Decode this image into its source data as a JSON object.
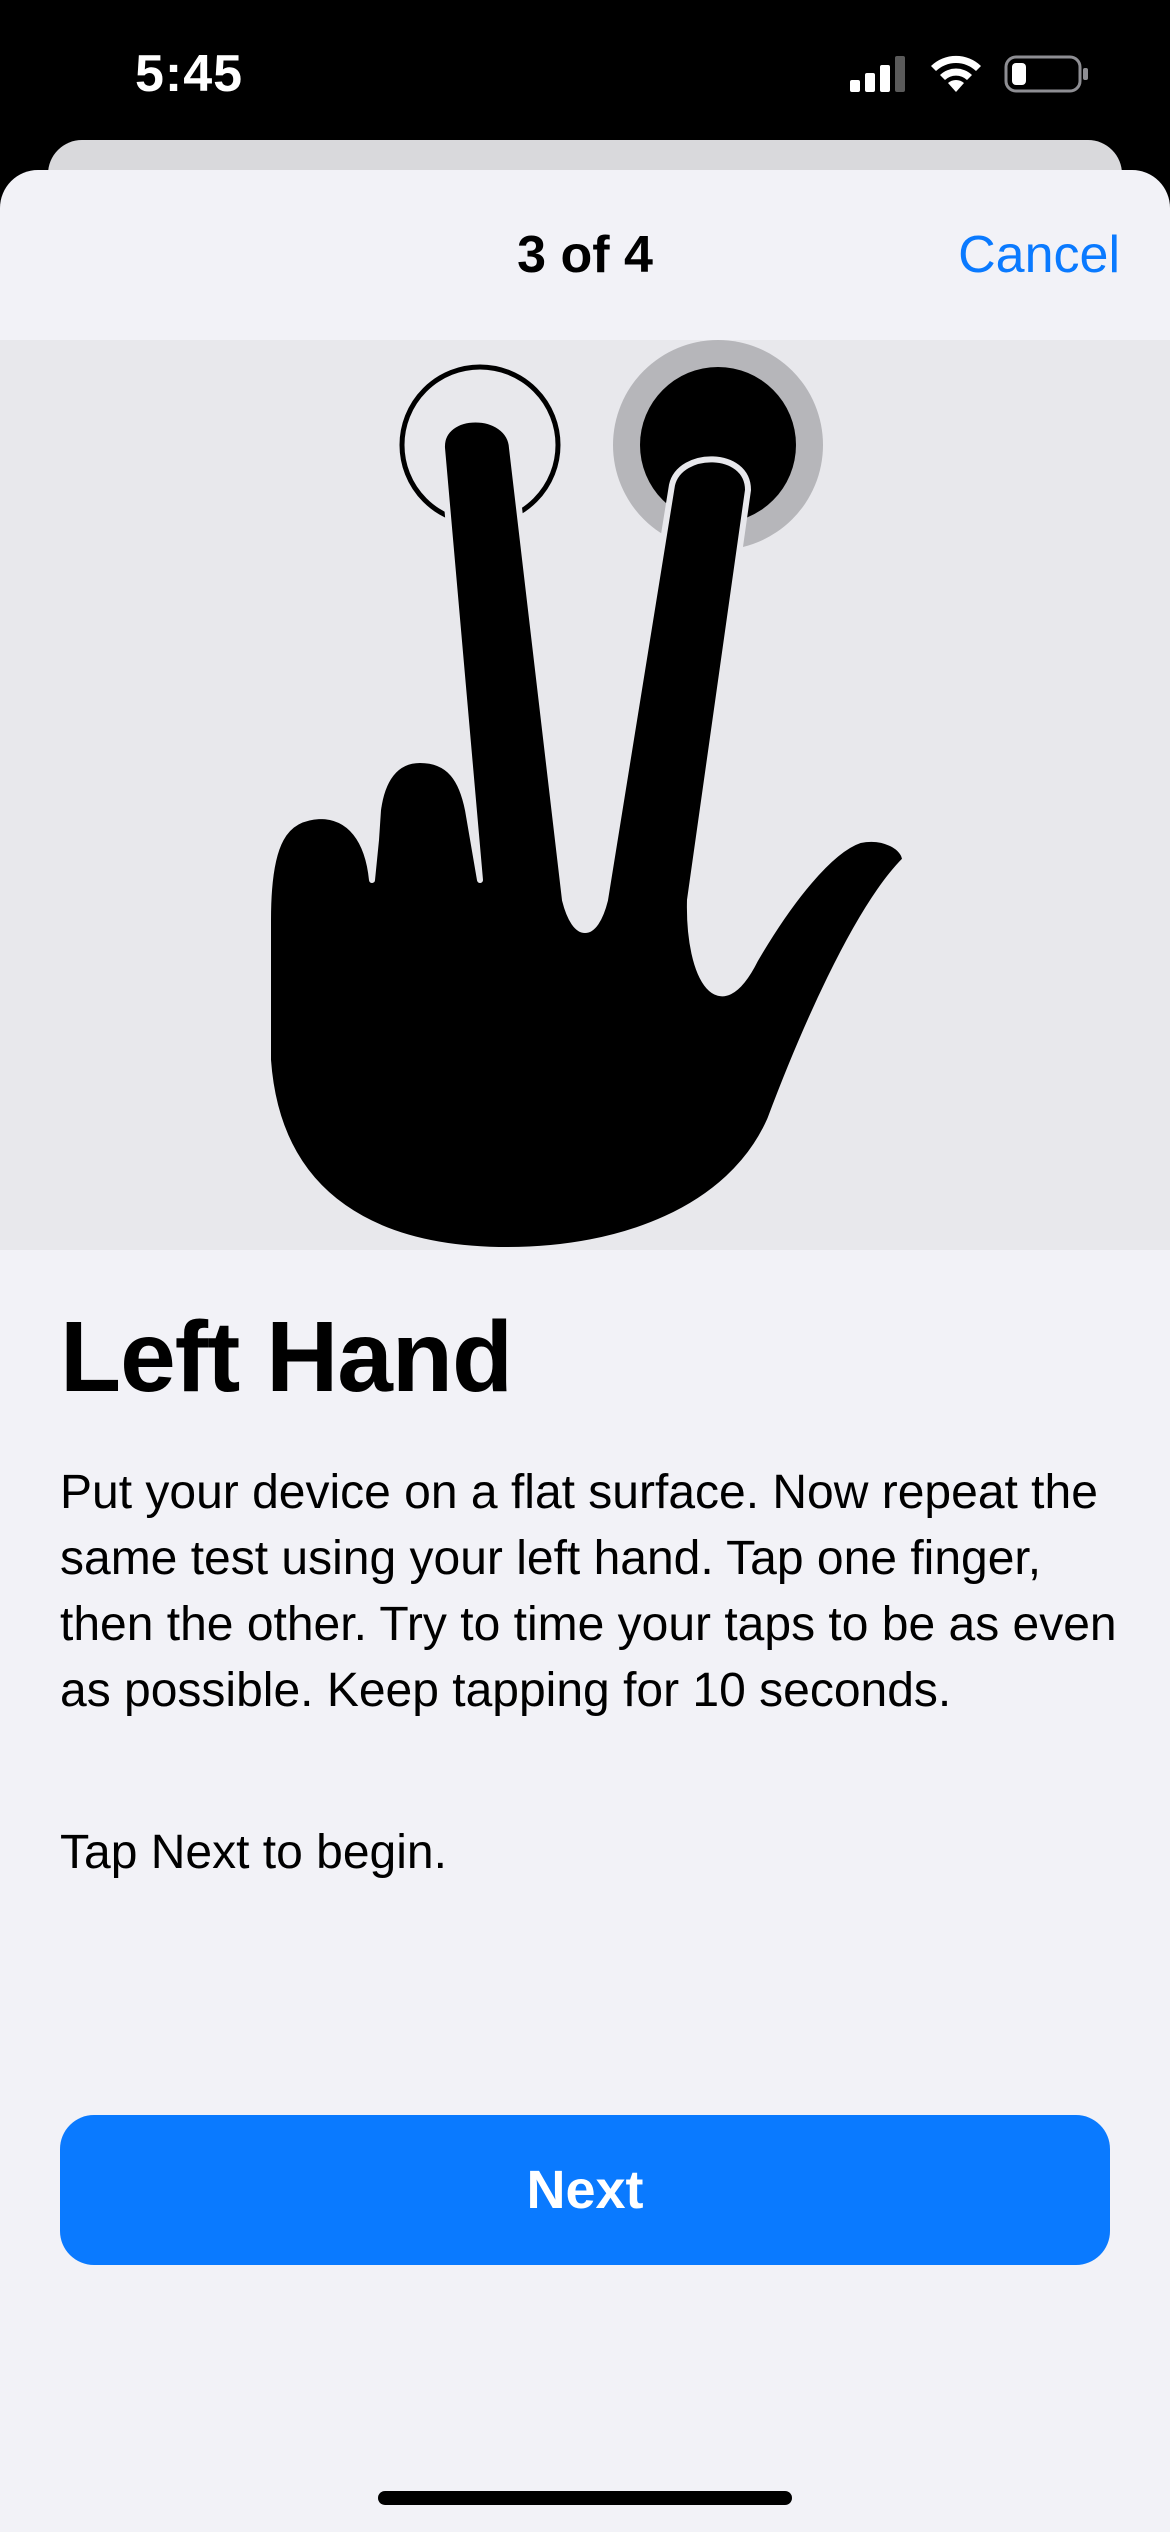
{
  "status_bar": {
    "time": "5:45",
    "icons": [
      "cellular-signal-icon",
      "wifi-icon",
      "battery-icon"
    ]
  },
  "nav": {
    "title": "3 of 4",
    "cancel_label": "Cancel"
  },
  "illustration": {
    "icon": "two-finger-tap-hand-icon"
  },
  "content": {
    "heading": "Left Hand",
    "body": "Put your device on a flat surface. Now repeat the same test using your left hand. Tap one finger, then the other. Try to time your taps to be as even as possible. Keep tapping for 10 seconds.",
    "sub": "Tap Next to begin."
  },
  "actions": {
    "next_label": "Next"
  },
  "colors": {
    "accent": "#0a7aff",
    "sheet_background": "#f2f2f7",
    "illustration_background": "#e8e8ec"
  }
}
